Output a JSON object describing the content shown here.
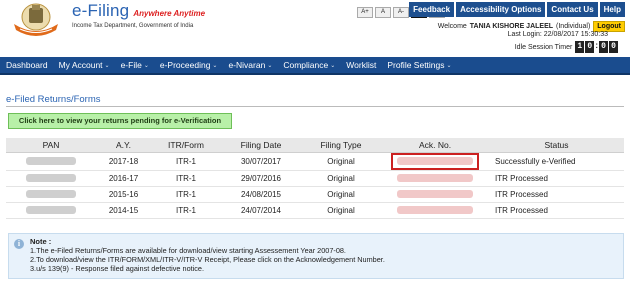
{
  "header": {
    "brand_title": "e-Filing",
    "brand_tagline": "Anywhere Anytime",
    "brand_subtitle": "Income Tax Department, Government of India",
    "font_buttons": [
      "A+",
      "A",
      "A-",
      "A",
      "A"
    ],
    "top_links": [
      "Feedback",
      "Accessibility Options",
      "Contact Us",
      "Help"
    ],
    "welcome_prefix": "Welcome",
    "user_name": "TANIA KISHORE JALEEL",
    "user_type": "(Individual)",
    "logout_label": "Logout",
    "last_login": "Last Login: 22/08/2017 15:30:33",
    "idle_label": "Idle Session Timer",
    "timer_digits": [
      "1",
      "0",
      "0",
      "0"
    ],
    "colors": {
      "brand": "#2b64b3",
      "nav": "#1a4c8e",
      "link_bg": "#1d4f8f",
      "logout": "#ffcc00"
    }
  },
  "nav": {
    "items": [
      "Dashboard",
      "My Account",
      "e-File",
      "e-Proceeding",
      "e-Nivaran",
      "Compliance",
      "Worklist",
      "Profile Settings"
    ]
  },
  "main": {
    "section_title": "e-Filed Returns/Forms",
    "everify_button": "Click here to view your returns pending for e-Verification",
    "table": {
      "headers": [
        "PAN",
        "A.Y.",
        "ITR/Form",
        "Filing Date",
        "Filing Type",
        "Ack. No.",
        "Status"
      ],
      "rows": [
        {
          "ay": "2017-18",
          "form": "ITR-1",
          "date": "30/07/2017",
          "type": "Original",
          "status": "Successfully e-Verified"
        },
        {
          "ay": "2016-17",
          "form": "ITR-1",
          "date": "29/07/2016",
          "type": "Original",
          "status": "ITR Processed"
        },
        {
          "ay": "2015-16",
          "form": "ITR-1",
          "date": "24/08/2015",
          "type": "Original",
          "status": "ITR Processed"
        },
        {
          "ay": "2014-15",
          "form": "ITR-1",
          "date": "24/07/2014",
          "type": "Original",
          "status": "ITR Processed"
        }
      ]
    },
    "note": {
      "title": "Note :",
      "lines": [
        "1.The e-Filed Returns/Forms are available for download/view starting Assessement Year 2007-08.",
        "2.To download/view the ITR/FORM/XML/ITR-V/ITR-V Receipt, Please click on the Acknowledgement Number.",
        "3.u/s 139(9) - Response filed against defective notice."
      ]
    }
  }
}
